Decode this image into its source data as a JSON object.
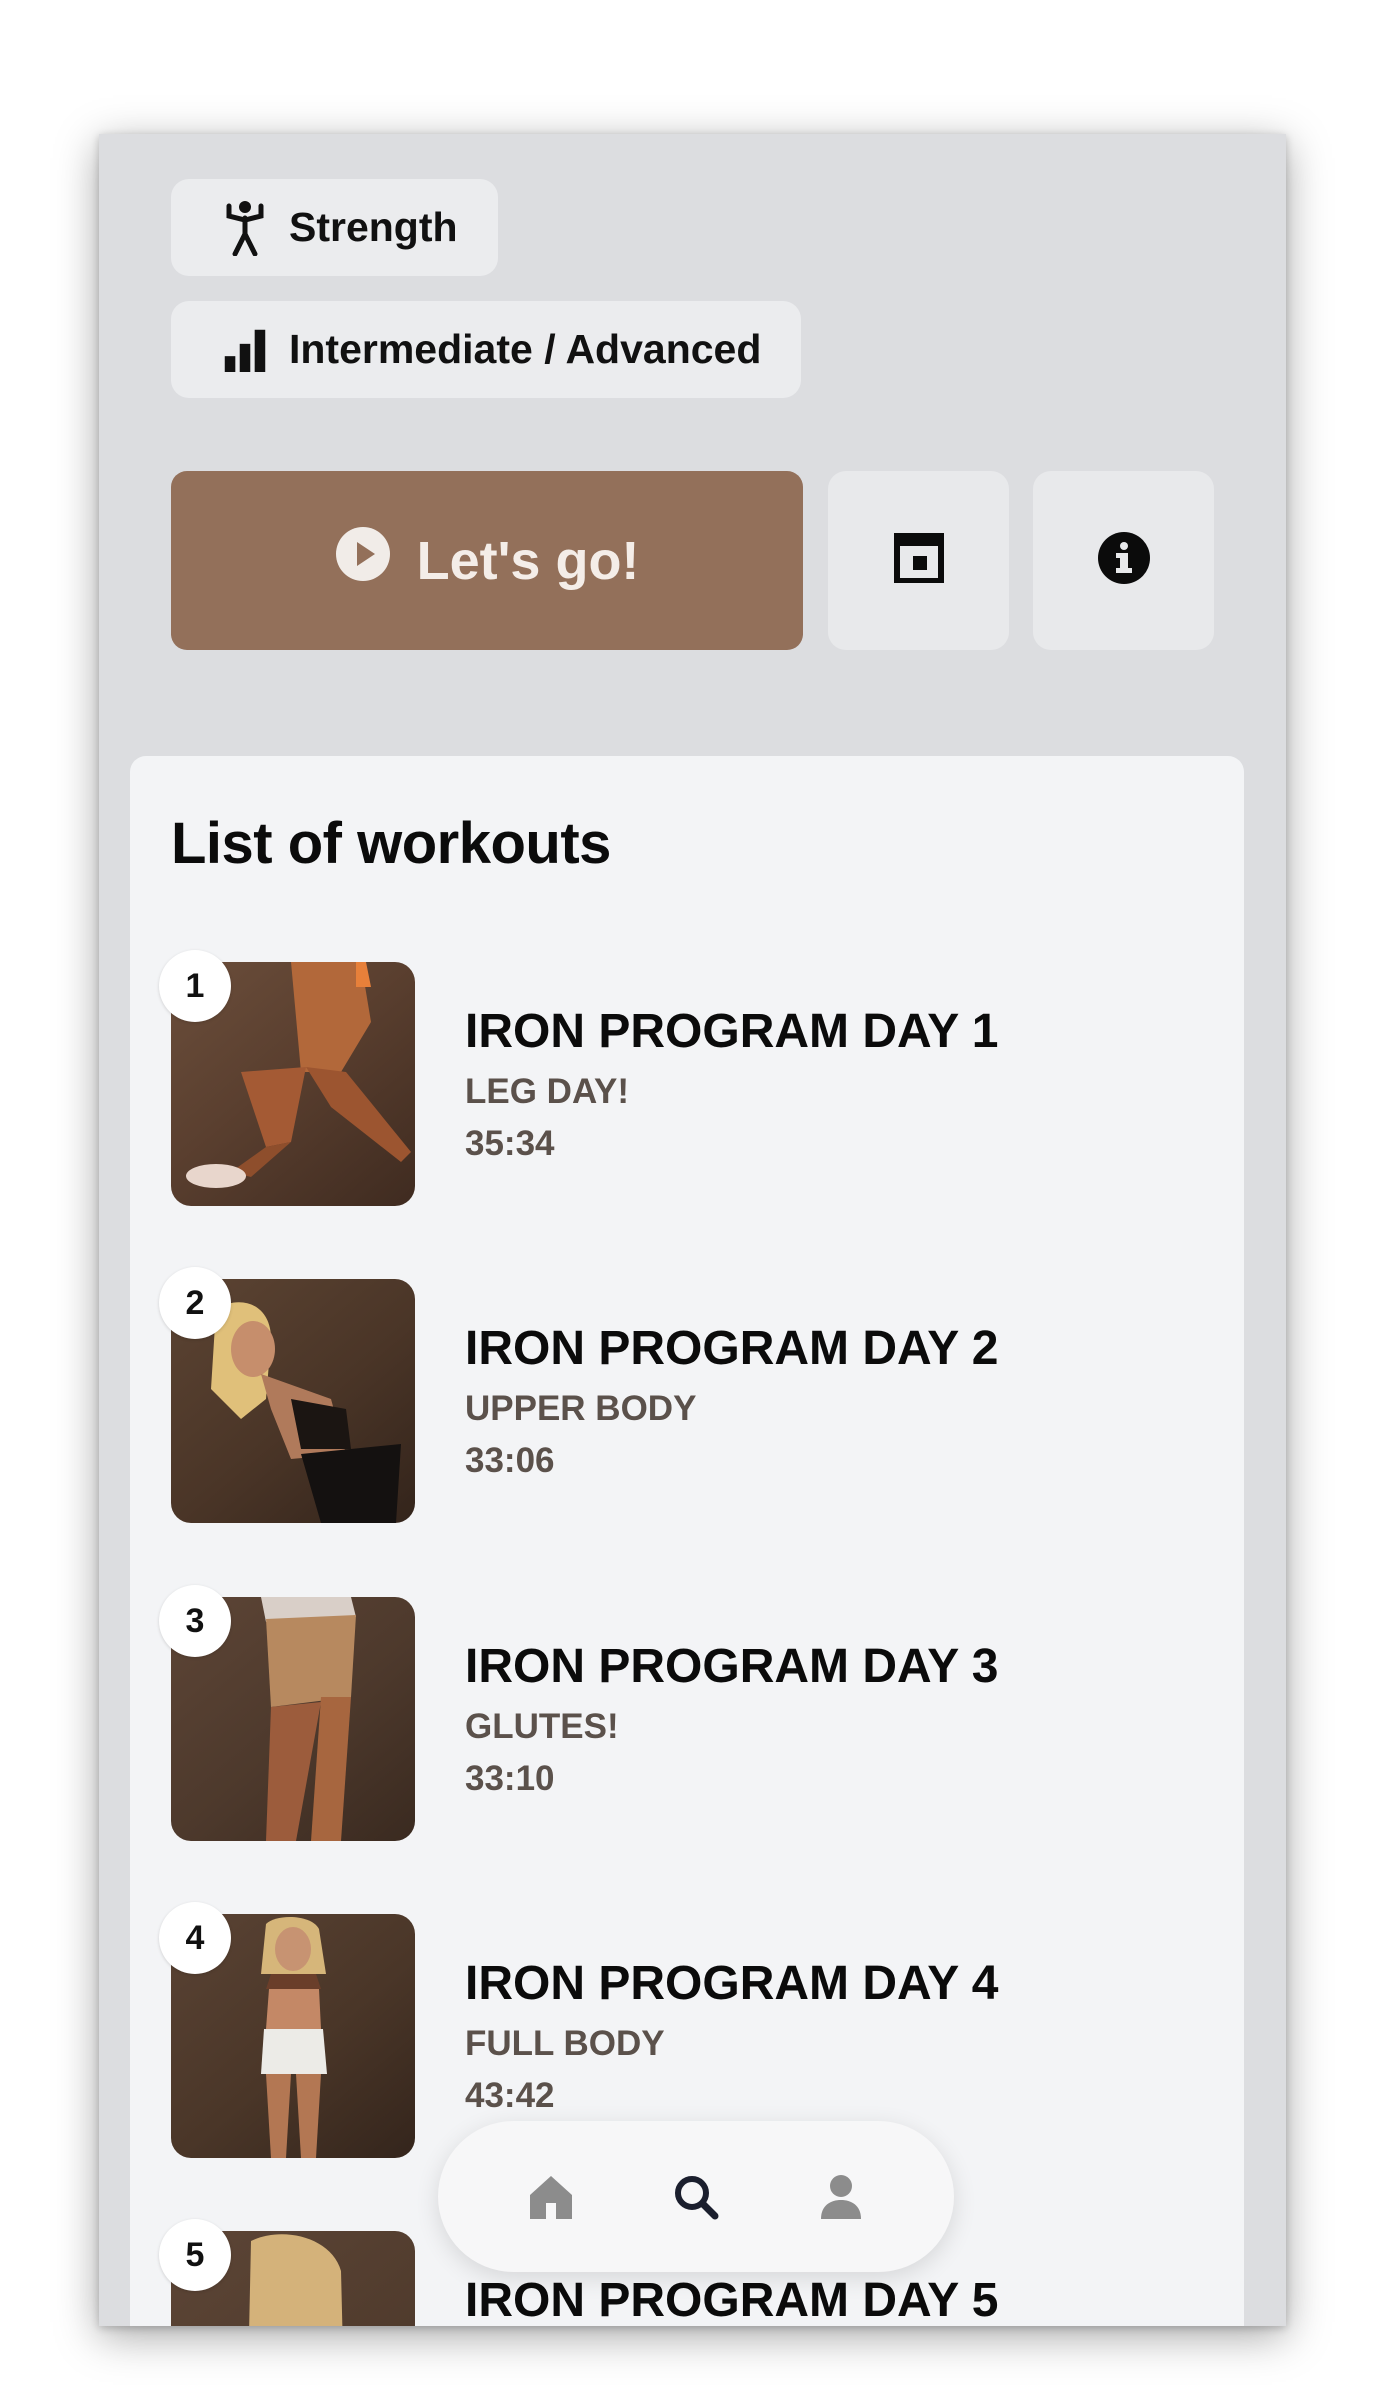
{
  "tags": [
    {
      "icon": "strength-figure-icon",
      "label": "Strength"
    },
    {
      "icon": "level-bars-icon",
      "label": "Intermediate / Advanced"
    }
  ],
  "actions": {
    "go_label": "Let's go!",
    "go_icon": "play-circle-icon",
    "calendar_icon": "calendar-icon",
    "info_icon": "info-icon"
  },
  "workouts_panel": {
    "title": "List of workouts",
    "items": [
      {
        "number": "1",
        "title": "IRON PROGRAM DAY 1",
        "subtitle": "LEG DAY!",
        "duration": "35:34"
      },
      {
        "number": "2",
        "title": "IRON PROGRAM DAY 2",
        "subtitle": "UPPER BODY",
        "duration": "33:06"
      },
      {
        "number": "3",
        "title": "IRON PROGRAM DAY 3",
        "subtitle": "GLUTES!",
        "duration": "33:10"
      },
      {
        "number": "4",
        "title": "IRON PROGRAM DAY 4",
        "subtitle": "FULL BODY",
        "duration": "43:42"
      },
      {
        "number": "5",
        "title": "IRON PROGRAM DAY 5",
        "subtitle": "",
        "duration": ""
      }
    ]
  },
  "bottom_nav": {
    "items": [
      {
        "icon": "home-icon",
        "active": false
      },
      {
        "icon": "search-icon",
        "active": true
      },
      {
        "icon": "profile-icon",
        "active": false
      }
    ]
  },
  "colors": {
    "accent": "#93705a",
    "background": "#dcdde0",
    "panel": "#f3f4f6",
    "nav_active": "#1b1f2e",
    "nav_inactive": "#8c8c8c"
  }
}
